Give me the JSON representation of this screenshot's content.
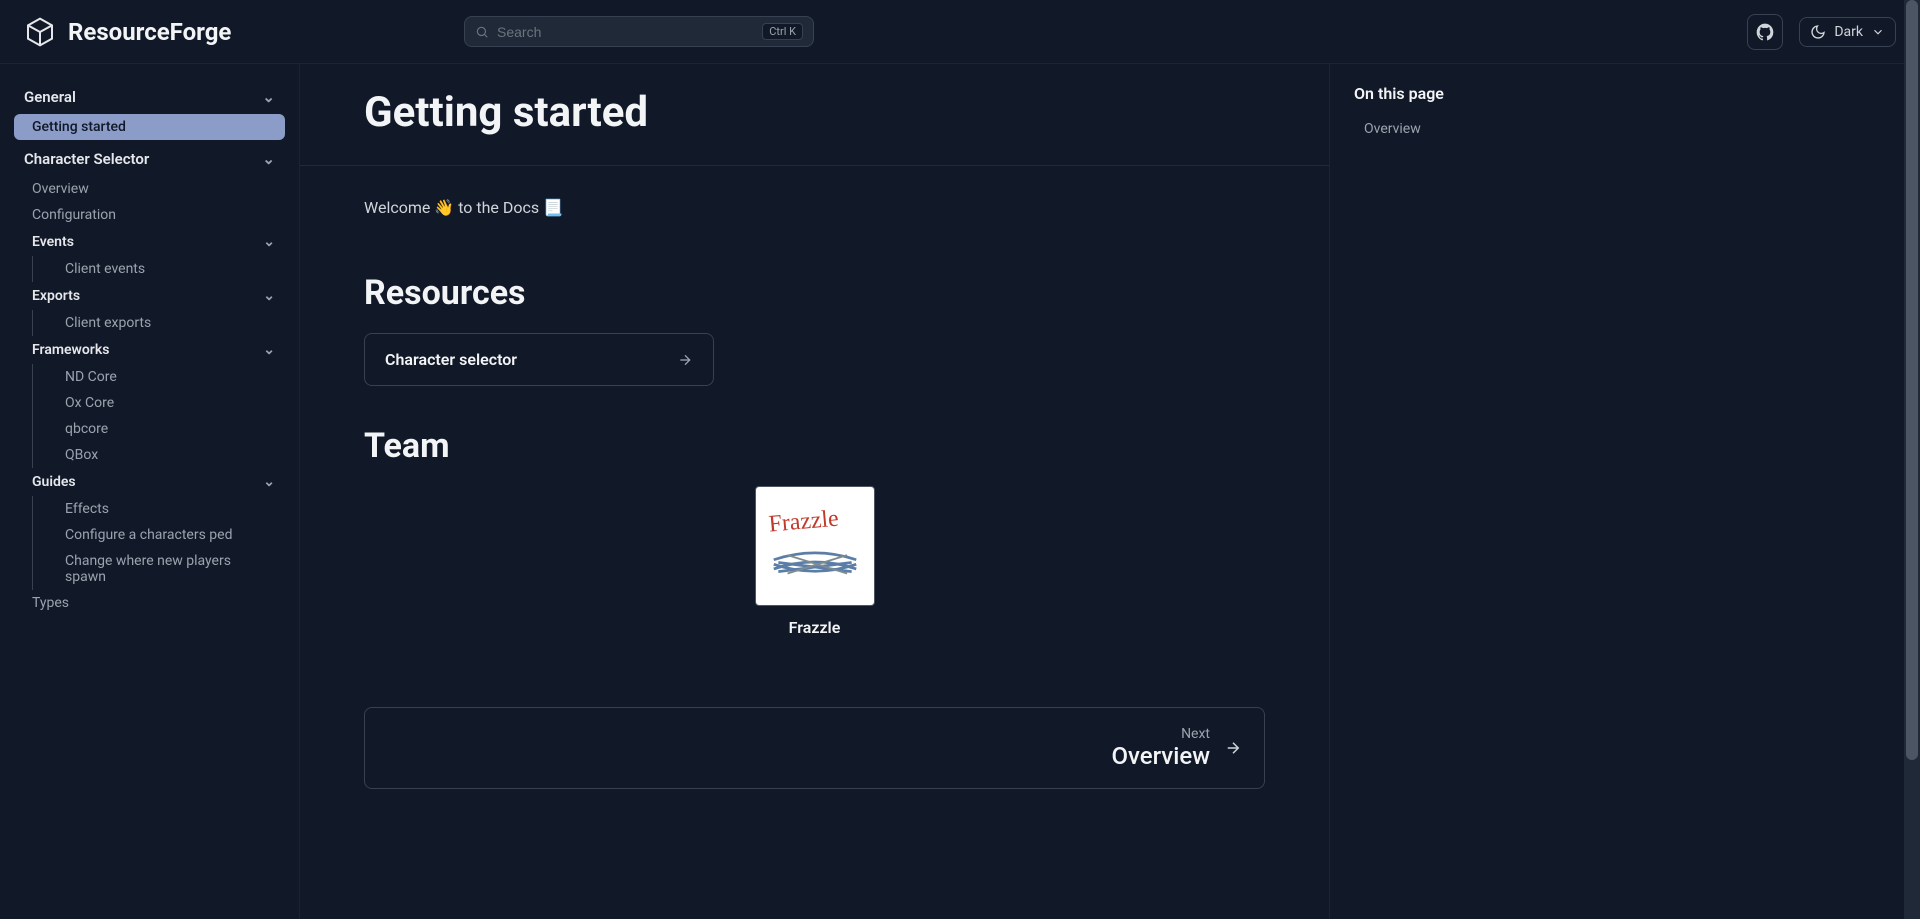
{
  "brand": "ResourceForge",
  "search": {
    "placeholder": "Search",
    "shortcut": "Ctrl K"
  },
  "theme": {
    "label": "Dark"
  },
  "sidebar": {
    "general": {
      "label": "General",
      "items": [
        "Getting started"
      ]
    },
    "charsel": {
      "label": "Character Selector",
      "overview": "Overview",
      "configuration": "Configuration",
      "events": {
        "label": "Events",
        "items": [
          "Client events"
        ]
      },
      "exports": {
        "label": "Exports",
        "items": [
          "Client exports"
        ]
      },
      "frameworks": {
        "label": "Frameworks",
        "items": [
          "ND Core",
          "Ox Core",
          "qbcore",
          "QBox"
        ]
      },
      "guides": {
        "label": "Guides",
        "items": [
          "Effects",
          "Configure a characters ped",
          "Change where new players spawn"
        ]
      },
      "types": "Types"
    }
  },
  "page": {
    "title": "Getting started",
    "welcome": "Welcome 👋 to the Docs 📃",
    "resources_heading": "Resources",
    "resource_card": "Character selector",
    "team_heading": "Team",
    "team_member": "Frazzle",
    "next": {
      "label": "Next",
      "title": "Overview"
    }
  },
  "toc": {
    "heading": "On this page",
    "items": [
      "Overview"
    ]
  }
}
